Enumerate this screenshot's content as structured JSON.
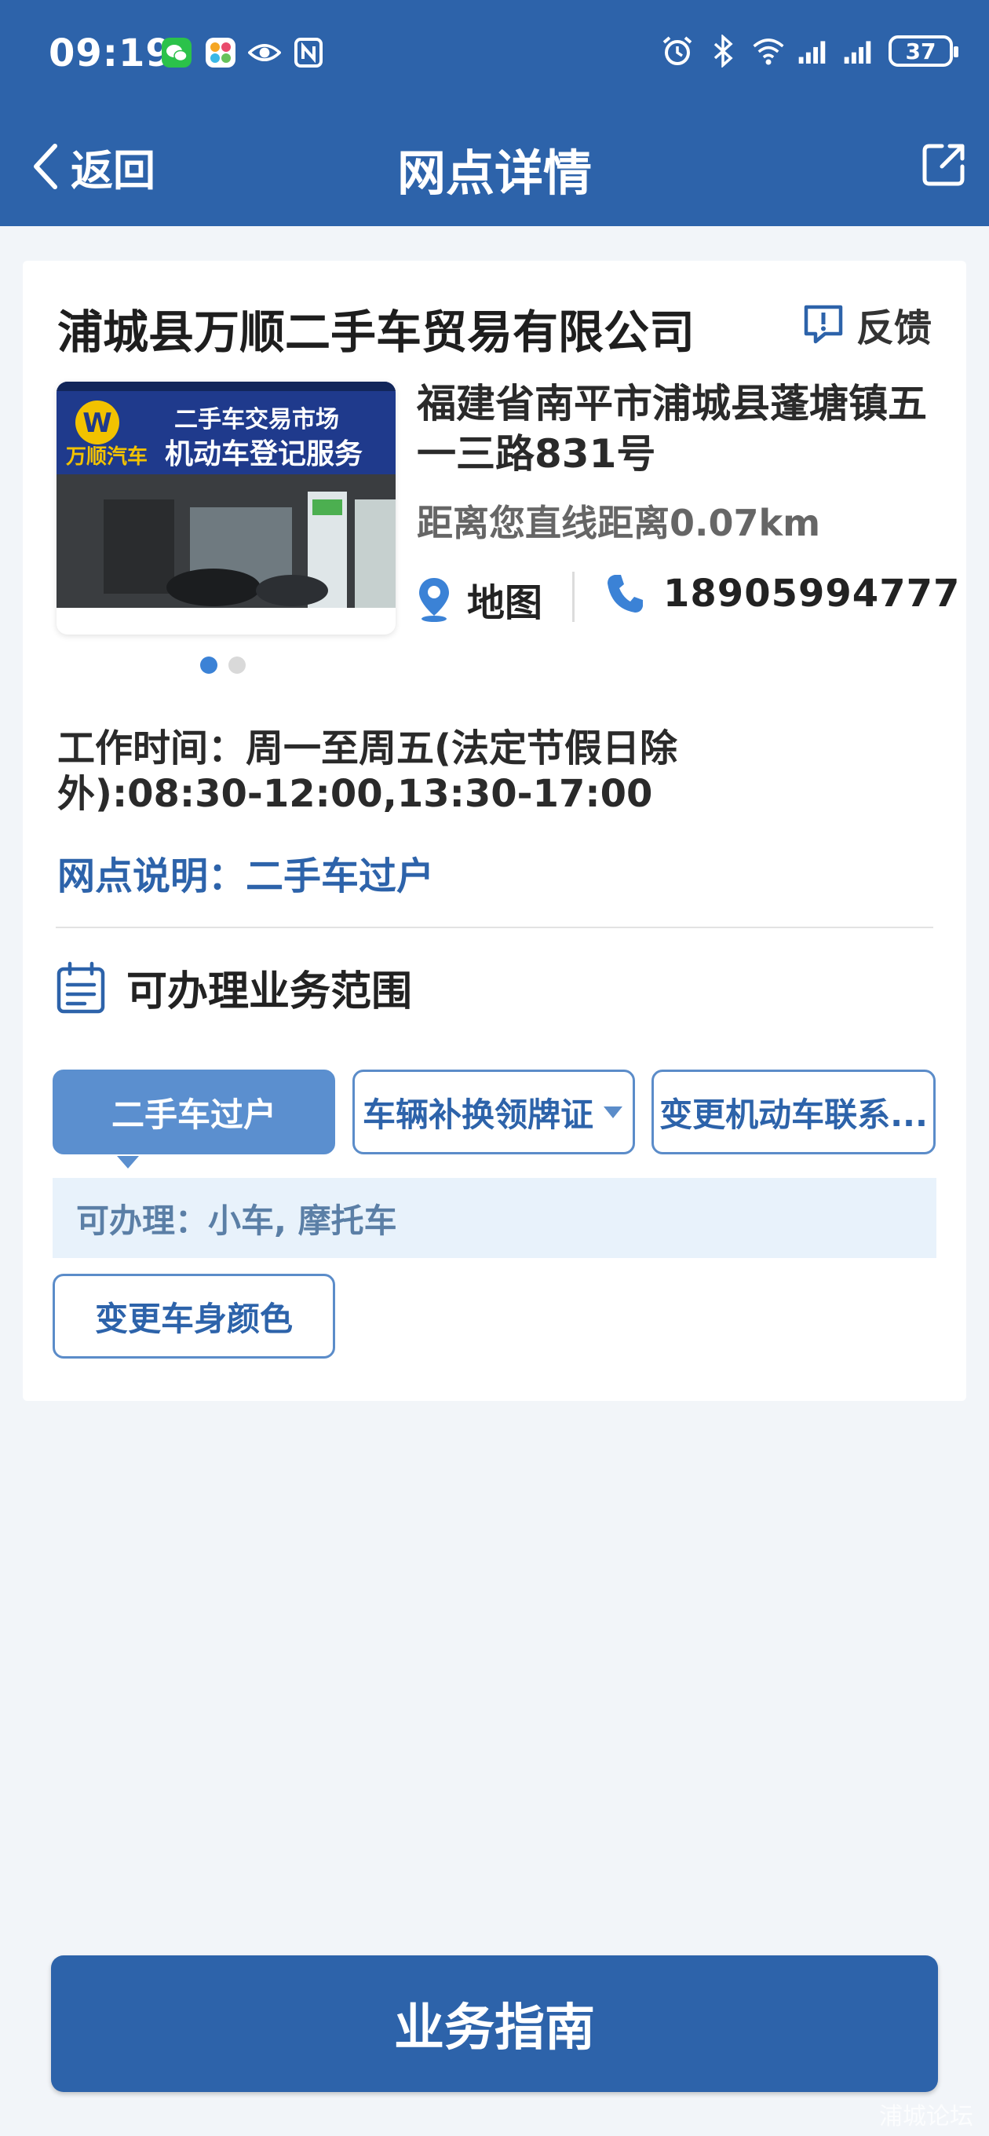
{
  "status_bar": {
    "time": "09:19",
    "left_icons": [
      "wechat-icon",
      "app-icon",
      "eye-icon",
      "nfc-icon"
    ],
    "right_icons": [
      "alarm-icon",
      "bluetooth-icon",
      "wifi-icon",
      "signal-icon",
      "signal-icon"
    ],
    "battery": "37"
  },
  "nav": {
    "back_label": "返回",
    "title": "网点详情",
    "share_icon": "external-link-icon"
  },
  "outlet": {
    "name": "浦城县万顺二手车贸易有限公司",
    "feedback_label": "反馈",
    "address": "福建省南平市浦城县蓬塘镇五一三路831号",
    "distance": "距离您直线距离0.07km",
    "map_label": "地图",
    "phone": "18905994777",
    "photo": {
      "sign_line1": "二手车交易市场",
      "sign_line2": "机动车登记服务",
      "brand": "万顺汽车"
    },
    "carousel": {
      "count": 2,
      "active": 0
    },
    "hours_label": "工作时间：",
    "hours_value": "周一至周五(法定节假日除外):08:30-12:00,13:30-17:00",
    "note_label": "网点说明：",
    "note_value": "二手车过户"
  },
  "scope": {
    "title": "可办理业务范围",
    "tags": [
      {
        "label": "二手车过户",
        "active": true
      },
      {
        "label": "车辆补换领牌证",
        "dropdown": true
      },
      {
        "label": "变更机动车联系..."
      },
      {
        "label": "变更车身颜色"
      }
    ],
    "applies_label": "可办理：",
    "applies_value": "小车, 摩托车"
  },
  "footer": {
    "primary_label": "业务指南",
    "watermark": "浦城论坛"
  },
  "colors": {
    "brand": "#2d63aa",
    "tag_active": "#5b8fcf",
    "page_bg": "#f2f5f9",
    "highlight_bg": "#e8f2fb"
  }
}
